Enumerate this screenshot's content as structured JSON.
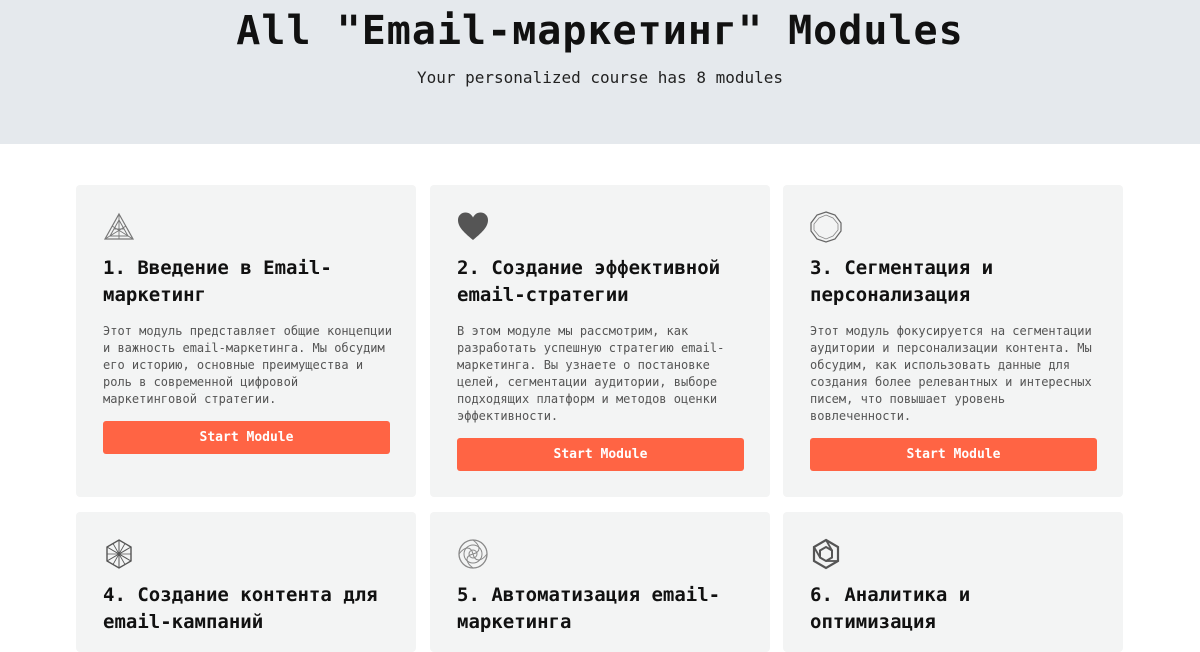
{
  "header": {
    "title": "All \"Email-маркетинг\" Modules",
    "subtitle": "Your personalized course has 8 modules"
  },
  "modules": [
    {
      "title": "1. Введение в Email-маркетинг",
      "description": "Этот модуль представляет общие концепции и важность email-маркетинга. Мы обсудим его историю, основные преимущества и роль в современной цифровой маркетинговой стратегии.",
      "button": "Start Module",
      "icon": "triangle-pattern-icon"
    },
    {
      "title": "2. Создание эффективной email-стратегии",
      "description": "В этом модуле мы рассмотрим, как разработать успешную стратегию email-маркетинга. Вы узнаете о постановке целей, сегментации аудитории, выборе подходящих платформ и методов оценки эффективности.",
      "button": "Start Module",
      "icon": "heart-icon"
    },
    {
      "title": "3. Сегментация и персонализация",
      "description": "Этот модуль фокусируется на сегментации аудитории и персонализации контента. Мы обсудим, как использовать данные для создания более релевантных и интересных писем, что повышает уровень вовлеченности.",
      "button": "Start Module",
      "icon": "polygon-ring-icon"
    },
    {
      "title": "4. Создание контента для email-кампаний",
      "icon": "hexagon-grid-icon"
    },
    {
      "title": "5. Автоматизация email-маркетинга",
      "icon": "spiral-ring-icon"
    },
    {
      "title": "6. Аналитика и оптимизация",
      "icon": "chain-hexagon-icon"
    }
  ],
  "colors": {
    "accent": "#ff6444",
    "hero_bg": "#e5e9ed",
    "card_bg": "#f3f4f4"
  }
}
